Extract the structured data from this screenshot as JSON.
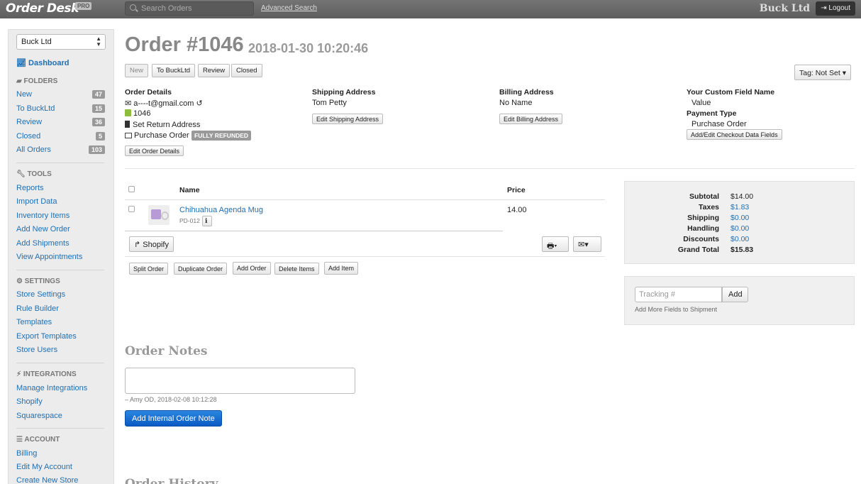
{
  "topbar": {
    "logo": "Order Desk",
    "logo_badge": "PRO",
    "search_placeholder": "Search Orders",
    "advanced_search": "Advanced Search",
    "store_name": "Buck Ltd",
    "logout": "Logout"
  },
  "sidebar": {
    "store_select": "Buck Ltd",
    "dashboard": "Dashboard",
    "folders_head": "FOLDERS",
    "folders": [
      {
        "label": "New",
        "count": "47"
      },
      {
        "label": "To BuckLtd",
        "count": "15"
      },
      {
        "label": "Review",
        "count": "36"
      },
      {
        "label": "Closed",
        "count": "5"
      },
      {
        "label": "All Orders",
        "count": "103"
      }
    ],
    "tools_head": "TOOLS",
    "tools": [
      "Reports",
      "Import Data",
      "Inventory Items",
      "Add New Order",
      "Add Shipments",
      "View Appointments"
    ],
    "settings_head": "SETTINGS",
    "settings": [
      "Store Settings",
      "Rule Builder",
      "Templates",
      "Export Templates",
      "Store Users"
    ],
    "integrations_head": "INTEGRATIONS",
    "integrations": [
      "Manage Integrations",
      "Shopify",
      "Squarespace"
    ],
    "account_head": "ACCOUNT",
    "account": [
      "Billing",
      "Edit My Account",
      "Create New Store"
    ]
  },
  "order": {
    "title": "Order #1046",
    "date": "2018-01-30 10:20:46",
    "folder_buttons": [
      "New",
      "To BuckLtd",
      "Review",
      "Closed"
    ],
    "tag_button": "Tag: Not Set",
    "details_label": "Order Details",
    "email": "a----t@gmail.com",
    "source_id": "1046",
    "return_address": "Set Return Address",
    "payment": "Purchase Order",
    "refund_badge": "FULLY REFUNDED",
    "edit_details": "Edit Order Details",
    "shipping_label": "Shipping Address",
    "shipping_name": "Tom Petty",
    "edit_shipping": "Edit Shipping Address",
    "billing_label": "Billing Address",
    "billing_name": "No Name",
    "edit_billing": "Edit Billing Address",
    "custom_field_label": "Your Custom Field Name",
    "custom_field_value": "Value",
    "payment_type_label": "Payment Type",
    "payment_type_value": "Purchase Order",
    "edit_checkout": "Add/Edit Checkout Data Fields"
  },
  "items": {
    "col_name": "Name",
    "col_price": "Price",
    "rows": [
      {
        "name": "Chihuahua Agenda Mug",
        "sku": "PD-012",
        "price": "14.00"
      }
    ],
    "shopify_button": "Shopify",
    "actions": [
      "Split Order",
      "Duplicate Order",
      "Add Order",
      "Delete Items",
      "Add Item"
    ]
  },
  "totals": {
    "rows": [
      {
        "label": "Subtotal",
        "value": "$14.00"
      },
      {
        "label": "Taxes",
        "value": "$1.83"
      },
      {
        "label": "Shipping",
        "value": "$0.00"
      },
      {
        "label": "Handling",
        "value": "$0.00"
      },
      {
        "label": "Discounts",
        "value": "$0.00"
      },
      {
        "label": "Grand Total",
        "value": "$15.83"
      }
    ]
  },
  "tracking": {
    "placeholder": "Tracking #",
    "add": "Add",
    "more_fields": "Add More Fields to Shipment"
  },
  "notes": {
    "title": "Order Notes",
    "meta": "– Amy OD, 2018-02-08 10:12:28",
    "add_button": "Add Internal Order Note",
    "history_title": "Order History"
  }
}
